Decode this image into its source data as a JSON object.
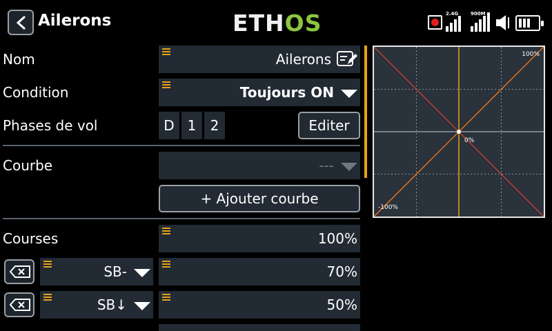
{
  "header": {
    "title": "Ailerons",
    "logo_left": "ETH",
    "logo_right": "OS",
    "signal_24": "2.4G",
    "signal_900": "900M"
  },
  "form": {
    "name_label": "Nom",
    "name_value": "Ailerons",
    "condition_label": "Condition",
    "condition_value": "Toujours ON",
    "phases_label": "Phases de vol",
    "phases": [
      "D",
      "1",
      "2"
    ],
    "edit_button": "Editer",
    "curve_label": "Courbe",
    "curve_value": "---",
    "add_curve_button": "+ Ajouter courbe",
    "courses_label": "Courses",
    "courses_value": "100%",
    "rates": [
      {
        "switch": "SB-",
        "value": "70%"
      },
      {
        "switch": "SB↓",
        "value": "50%"
      }
    ]
  },
  "graph": {
    "label_max": "100%",
    "label_center": "0%",
    "label_min": "-100%"
  },
  "colors": {
    "accent": "#e8a21a",
    "field_bg": "#222a33",
    "curve": "#e8731a",
    "mirror": "#e04030",
    "logo_green": "#8cc63f"
  }
}
